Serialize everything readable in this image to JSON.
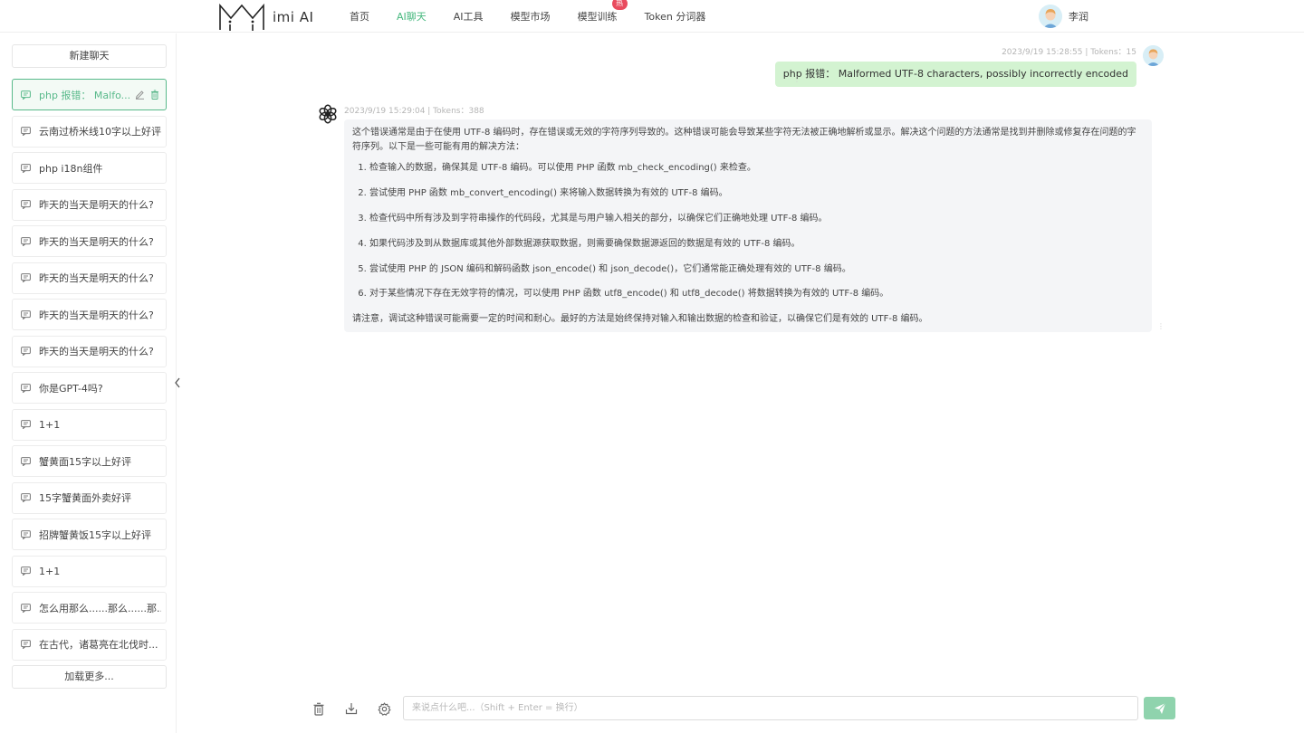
{
  "app": {
    "name": "imi AI"
  },
  "nav": {
    "items": [
      {
        "label": "首页"
      },
      {
        "label": "AI聊天"
      },
      {
        "label": "AI工具"
      },
      {
        "label": "模型市场"
      },
      {
        "label": "模型训练"
      },
      {
        "label": "Token 分词器"
      }
    ],
    "active_index": 1,
    "hot_badge": "热"
  },
  "user": {
    "name": "李润"
  },
  "sidebar": {
    "new_chat": "新建聊天",
    "load_more": "加载更多...",
    "items": [
      {
        "label": "php 报错： Malfo..."
      },
      {
        "label": "云南过桥米线10字以上好评"
      },
      {
        "label": "php i18n组件"
      },
      {
        "label": "昨天的当天是明天的什么?"
      },
      {
        "label": "昨天的当天是明天的什么?"
      },
      {
        "label": "昨天的当天是明天的什么?"
      },
      {
        "label": "昨天的当天是明天的什么?"
      },
      {
        "label": "昨天的当天是明天的什么?"
      },
      {
        "label": "你是GPT-4吗?"
      },
      {
        "label": "1+1"
      },
      {
        "label": "蟹黄面15字以上好评"
      },
      {
        "label": "15字蟹黄面外卖好评"
      },
      {
        "label": "招牌蟹黄饭15字以上好评"
      },
      {
        "label": "1+1"
      },
      {
        "label": "怎么用那么......那么......那..."
      },
      {
        "label": "在古代，诸葛亮在北伐时..."
      }
    ]
  },
  "messages": {
    "user": {
      "meta": "2023/9/19 15:28:55 | Tokens：15",
      "text": "php 报错： Malformed UTF-8 characters, possibly incorrectly encoded"
    },
    "bot": {
      "meta": "2023/9/19 15:29:04 | Tokens：388",
      "intro": "这个错误通常是由于在使用 UTF-8 编码时，存在错误或无效的字符序列导致的。这种错误可能会导致某些字符无法被正确地解析或显示。解决这个问题的方法通常是找到并删除或修复存在问题的字符序列。以下是一些可能有用的解决方法：",
      "steps": [
        "检查输入的数据，确保其是 UTF-8 编码。可以使用 PHP 函数 mb_check_encoding() 来检查。",
        "尝试使用 PHP 函数 mb_convert_encoding() 来将输入数据转换为有效的 UTF-8 编码。",
        "检查代码中所有涉及到字符串操作的代码段，尤其是与用户输入相关的部分，以确保它们正确地处理 UTF-8 编码。",
        "如果代码涉及到从数据库或其他外部数据源获取数据，则需要确保数据源返回的数据是有效的 UTF-8 编码。",
        "尝试使用 PHP 的 JSON 编码和解码函数 json_encode() 和 json_decode()，它们通常能正确处理有效的 UTF-8 编码。",
        "对于某些情况下存在无效字符的情况，可以使用 PHP 函数 utf8_encode() 和 utf8_decode() 将数据转换为有效的 UTF-8 编码。"
      ],
      "outro": "请注意，调试这种错误可能需要一定的时间和耐心。最好的方法是始终保持对输入和输出数据的检查和验证，以确保它们是有效的 UTF-8 编码。"
    }
  },
  "input": {
    "placeholder": "来说点什么吧...（Shift + Enter = 换行）"
  },
  "colors": {
    "accent": "#46b87e",
    "user_bubble": "#d3f3d1",
    "bot_bubble": "#f4f5f7",
    "send_button": "#8fd3ad",
    "hot_badge": "#e94b5e"
  }
}
